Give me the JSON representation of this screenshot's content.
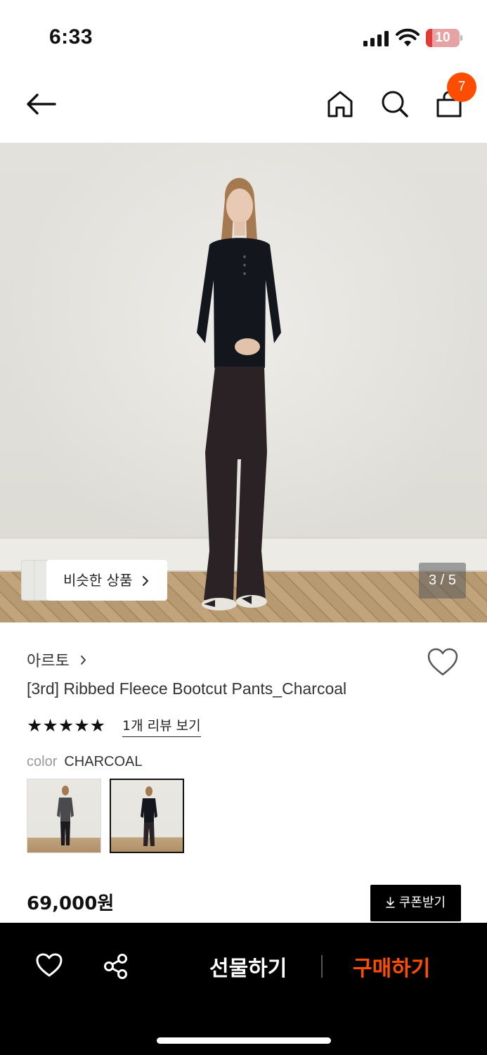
{
  "status_bar": {
    "time": "6:33",
    "battery": "10"
  },
  "header": {
    "cart_count": "7"
  },
  "gallery": {
    "similar_label": "비슷한 상품",
    "page_counter": "3 / 5"
  },
  "product": {
    "brand": "아르토",
    "title": "[3rd] Ribbed Fleece Bootcut Pants_Charcoal",
    "stars": "★★★★★",
    "rating": 5,
    "review_link": "1개 리뷰 보기",
    "color_label": "color",
    "color_value": "CHARCOAL",
    "price": "69,000원",
    "coupon_label": "쿠폰받기"
  },
  "bottom_bar": {
    "gift_label": "선물하기",
    "buy_label": "구매하기"
  },
  "colors": {
    "accent": "#ff4d00",
    "bottom_bar_bg": "#000000"
  },
  "icons": [
    "back-arrow-icon",
    "home-icon",
    "search-icon",
    "shopping-bag-icon",
    "chevron-right-icon",
    "heart-icon",
    "share-icon",
    "download-icon",
    "signal-icon",
    "wifi-icon",
    "battery-icon"
  ]
}
